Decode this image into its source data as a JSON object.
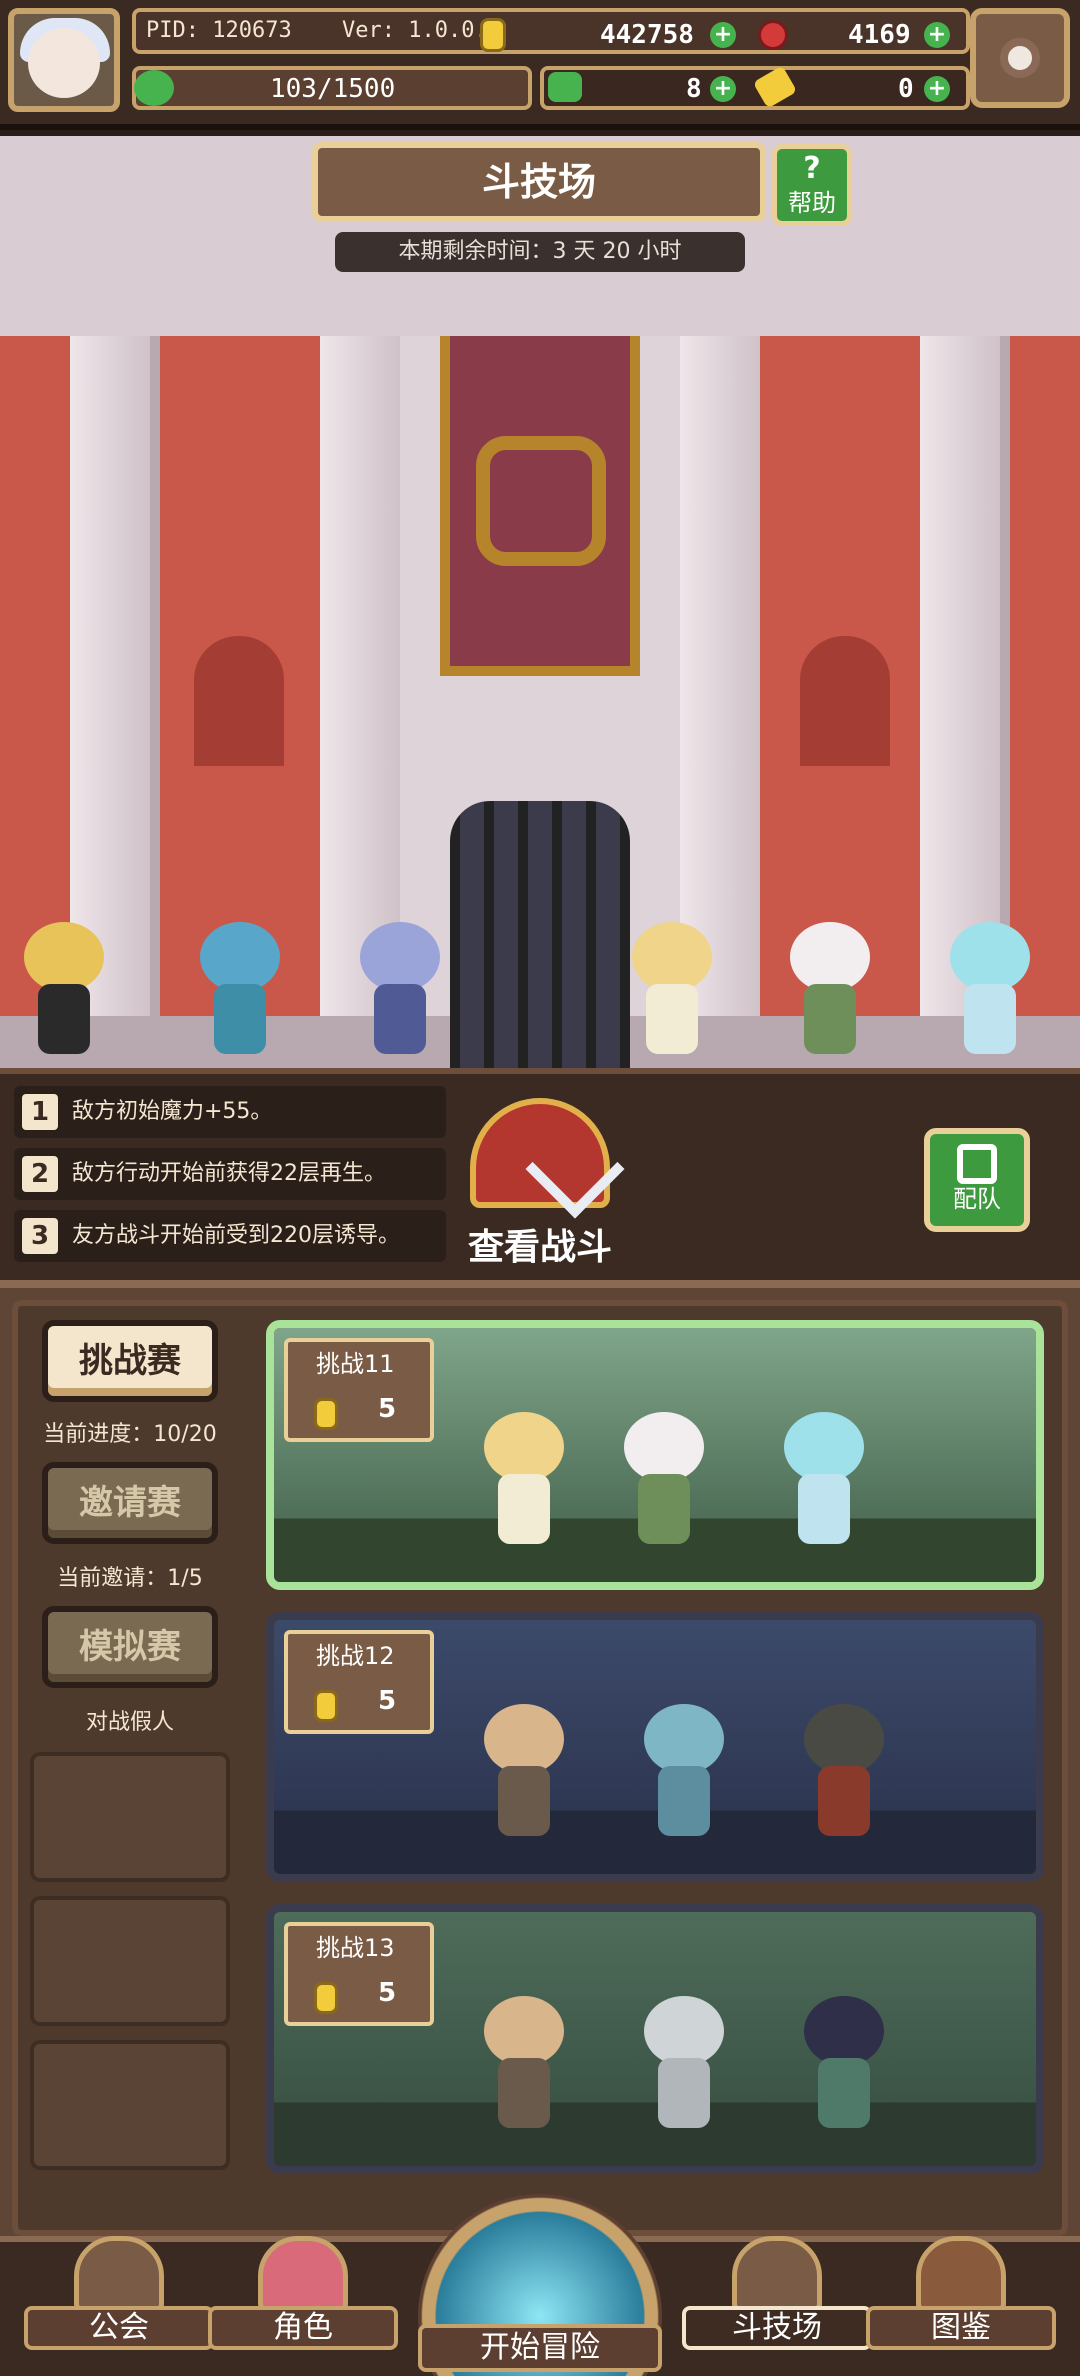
{
  "status_bar": {
    "pid": "PID: 120673",
    "version": "Ver: 1.0.0.1",
    "coins": "442758",
    "gems": "4169",
    "stamina": "103/1500",
    "clovers": "8",
    "tickets": "0"
  },
  "arena": {
    "title": "斗技场",
    "help_label": "帮助",
    "remaining_time": "本期剩余时间：3 天 20 小时"
  },
  "buffs": [
    {
      "num": "1",
      "text": "敌方初始魔力+55。"
    },
    {
      "num": "2",
      "text": "敌方行动开始前获得22层再生。"
    },
    {
      "num": "3",
      "text": "友方战斗开始前受到220层诱导。"
    }
  ],
  "actions": {
    "view_battle": "查看战斗",
    "team": "配队"
  },
  "sidebar": {
    "challenge": {
      "label": "挑战赛",
      "sub": "当前进度：10/20"
    },
    "invite": {
      "label": "邀请赛",
      "sub": "当前邀请：1/5"
    },
    "simulate": {
      "label": "模拟赛",
      "sub": "对战假人"
    }
  },
  "challenges": [
    {
      "label": "挑战11",
      "cost": "5"
    },
    {
      "label": "挑战12",
      "cost": "5"
    },
    {
      "label": "挑战13",
      "cost": "5"
    }
  ],
  "nav": {
    "guild": "公会",
    "roles": "角色",
    "adventure": "开始冒险",
    "arena": "斗技场",
    "codex": "图鉴"
  },
  "colors": {
    "accent_green": "#3e9a3e",
    "gold_border": "#c7a26a",
    "active_card_border": "#a9e39a"
  }
}
